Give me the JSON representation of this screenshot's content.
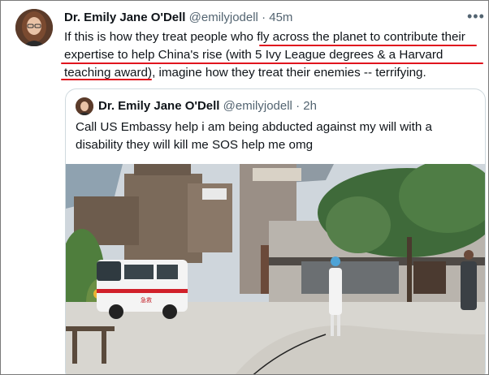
{
  "tweet": {
    "author_name": "Dr. Emily Jane O'Dell",
    "handle": "@emilyjodell",
    "separator": "·",
    "time": "45m",
    "more_icon": "more-horizontal-icon",
    "text_lines": [
      "If this is how they treat people who fly across the planet to contribute their",
      "expertise to help China's rise (with 5 Ivy League degrees & a Harvard",
      "teaching award), imagine how they treat their enemies -- terrifying."
    ],
    "highlight_color": "#e0141e"
  },
  "quoted_tweet": {
    "author_name": "Dr. Emily Jane O'Dell",
    "handle": "@emilyjodell",
    "separator": "·",
    "time": "2h",
    "text_lines": [
      "Call US Embassy help i am being abducted against my will with a",
      "disability they will kill me SOS help me omg"
    ],
    "photo_alt": "photo-courtyard-with-ambulance",
    "ambulance_text": "急救"
  }
}
